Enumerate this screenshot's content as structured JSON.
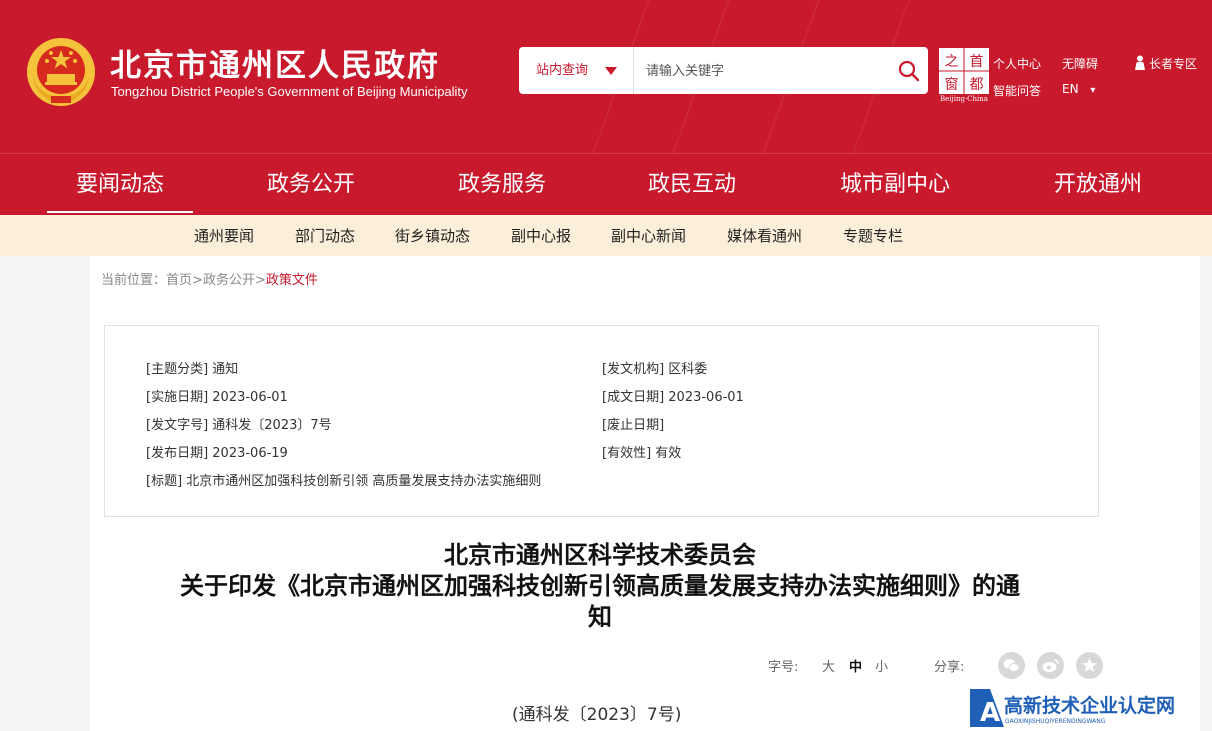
{
  "header": {
    "title": "北京市通州区人民政府",
    "subtitle": "Tongzhou District People's Government of Beijing Municipality",
    "search_scope": "站内查询",
    "search_placeholder": "请输入关键字",
    "capital_logo": {
      "chars": [
        "首",
        "都",
        "之",
        "窗"
      ],
      "caption": "Beijing·China"
    },
    "links": {
      "personal": "个人中心",
      "accessible": "无障碍",
      "qa": "智能问答",
      "lang": "EN",
      "lang_arrow": "▾",
      "elder": "长者专区"
    }
  },
  "nav": [
    "要闻动态",
    "政务公开",
    "政务服务",
    "政民互动",
    "城市副中心",
    "开放通州"
  ],
  "subnav": [
    "通州要闻",
    "部门动态",
    "街乡镇动态",
    "副中心报",
    "副中心新闻",
    "媒体看通州",
    "专题专栏"
  ],
  "breadcrumb": {
    "label": "当前位置：",
    "home": "首页",
    "sep": ">",
    "parent": "政务公开",
    "current": "政策文件"
  },
  "meta": {
    "topic": "[主题分类] 通知",
    "org": "[发文机构] 区科委",
    "effective": "[实施日期] 2023-06-01",
    "created": "[成文日期] 2023-06-01",
    "doc_no": "[发文字号] 通科发〔2023〕7号",
    "repeal": "[废止日期]",
    "published": "[发布日期] 2023-06-19",
    "validity": "[有效性] 有效",
    "subject": "[标题] 北京市通州区加强科技创新引领 高质量发展支持办法实施细则"
  },
  "article": {
    "title_line1": "北京市通州区科学技术委员会",
    "title_line2": "关于印发《北京市通州区加强科技创新引领高质量发展支持办法实施细则》的通",
    "title_line3": "知",
    "font_label": "字号:",
    "font_large": "大",
    "font_medium": "中",
    "font_small": "小",
    "share_label": "分享:",
    "doc_number": "(通科发〔2023〕7号)"
  },
  "watermark": {
    "cn": "高新技术企业认定网",
    "en": "GAOXINJISHUQIYERENDINGWANG",
    "letter": "A"
  },
  "colors": {
    "brand_red": "#c8192d",
    "subnav_bg": "#fcefd9",
    "gold": "#f5c33b"
  }
}
